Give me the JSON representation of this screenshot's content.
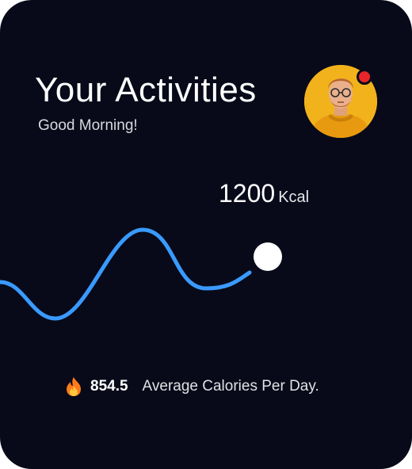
{
  "header": {
    "title": "Your Activities",
    "greeting": "Good Morning!"
  },
  "avatar": {
    "icon": "user-avatar",
    "has_notification": true,
    "notification_color": "#e8262a"
  },
  "chart": {
    "current_value": "1200",
    "current_unit": "Kcal",
    "line_color": "#3a9aff"
  },
  "summary": {
    "icon": "fire-icon",
    "value": "854.5",
    "label": "Average Calories Per Day."
  },
  "colors": {
    "background": "#080a19",
    "accent": "#3a9aff",
    "text": "#ffffff"
  }
}
